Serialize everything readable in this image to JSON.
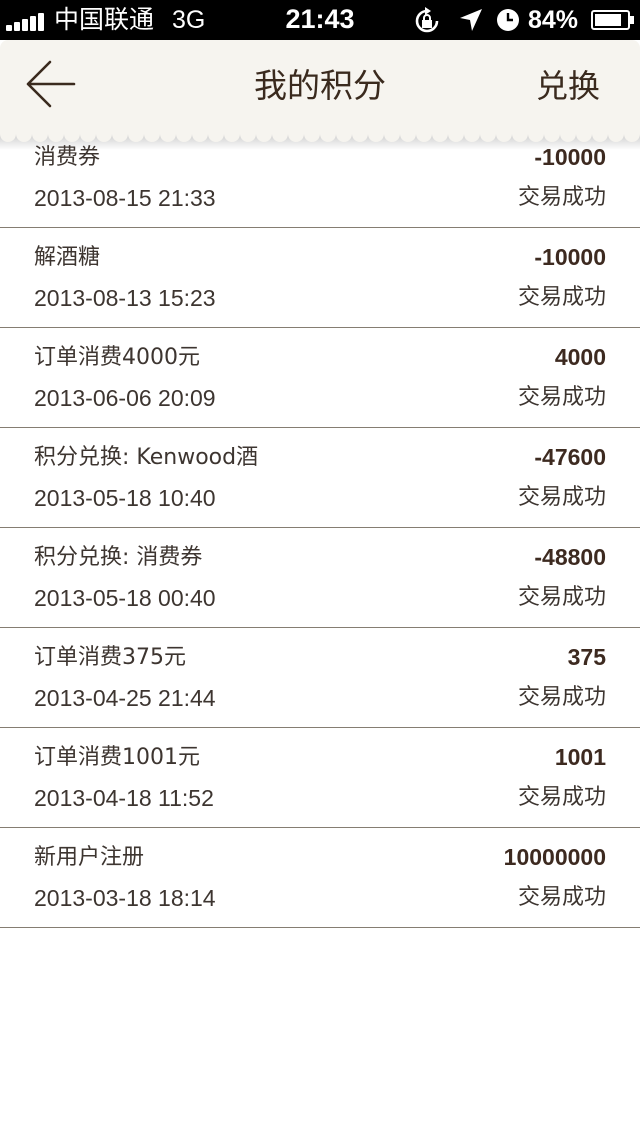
{
  "status_bar": {
    "carrier": "中国联通",
    "network": "3G",
    "time": "21:43",
    "battery": "84%",
    "signal_bars": 5,
    "battery_level": 0.84
  },
  "nav": {
    "title": "我的积分",
    "action_label": "兑换",
    "back_icon": "back-arrow-icon"
  },
  "transactions": [
    {
      "title": "消费券",
      "points": "-10000",
      "datetime": "2013-08-15 21:33",
      "status": "交易成功"
    },
    {
      "title": "解酒糖",
      "points": "-10000",
      "datetime": "2013-08-13 15:23",
      "status": "交易成功"
    },
    {
      "title": "订单消费4000元",
      "points": "4000",
      "datetime": "2013-06-06 20:09",
      "status": "交易成功"
    },
    {
      "title": "积分兑换: Kenwood酒",
      "points": "-47600",
      "datetime": "2013-05-18 10:40",
      "status": "交易成功"
    },
    {
      "title": "积分兑换: 消费券",
      "points": "-48800",
      "datetime": "2013-05-18 00:40",
      "status": "交易成功"
    },
    {
      "title": "订单消费375元",
      "points": "375",
      "datetime": "2013-04-25 21:44",
      "status": "交易成功"
    },
    {
      "title": "订单消费1001元",
      "points": "1001",
      "datetime": "2013-04-18 11:52",
      "status": "交易成功"
    },
    {
      "title": "新用户注册",
      "points": "10000000",
      "datetime": "2013-03-18 18:14",
      "status": "交易成功"
    }
  ],
  "colors": {
    "status_bar_bg": "#000000",
    "nav_bg": "#f6f4ef",
    "text_dark": "#3a2a1e",
    "divider": "#857d72"
  }
}
